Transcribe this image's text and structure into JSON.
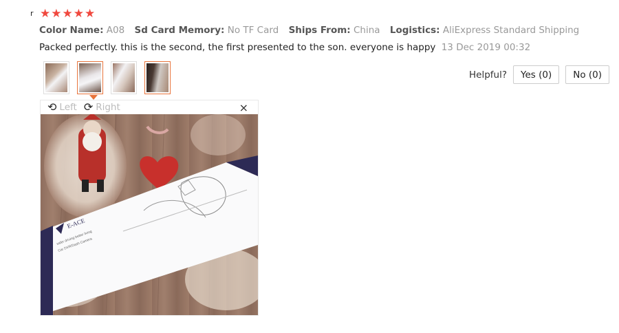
{
  "review": {
    "corner_mark": "r",
    "rating_stars": 5,
    "star_glyph": "★",
    "properties": [
      {
        "key": "Color Name:",
        "value": "A08"
      },
      {
        "key": "Sd Card Memory:",
        "value": "No TF Card"
      },
      {
        "key": "Ships From:",
        "value": "China"
      },
      {
        "key": "Logistics:",
        "value": "AliExpress Standard Shipping"
      }
    ],
    "comment": "Packed perfectly. this is the second, the first presented to the son. everyone is happy",
    "date": "13 Dec 2019 00:32",
    "thumbnails": [
      "photo-1",
      "photo-2",
      "photo-3",
      "photo-4"
    ],
    "active_thumbnail": 1
  },
  "helpful": {
    "label": "Helpful?",
    "yes": "Yes (0)",
    "no": "No (0)"
  },
  "viewer": {
    "rotate_left": "Left",
    "rotate_right": "Right",
    "close": "×",
    "box_brand": "E-ACE",
    "box_tagline": "safer driving better living",
    "box_product": "Car DVR/Dash Camera"
  },
  "colors": {
    "star": "#f0483e",
    "accent": "#e8733a"
  }
}
